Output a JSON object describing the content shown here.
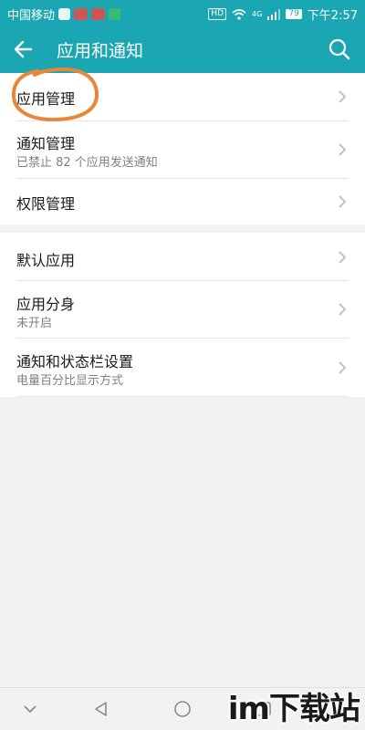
{
  "statusbar": {
    "carrier": "中国移动",
    "hd": "HD",
    "signal": "4G",
    "battery": "79",
    "time": "下午2:57",
    "app_icons": [
      "browser-icon",
      "news-icon",
      "video-icon",
      "play-icon"
    ]
  },
  "appbar": {
    "title": "应用和通知",
    "back_icon": "arrow-left-icon",
    "search_icon": "search-icon"
  },
  "group1": [
    {
      "label": "应用管理",
      "sub": ""
    },
    {
      "label": "通知管理",
      "sub": "已禁止 82 个应用发送通知"
    },
    {
      "label": "权限管理",
      "sub": ""
    }
  ],
  "group2": [
    {
      "label": "默认应用",
      "sub": ""
    },
    {
      "label": "应用分身",
      "sub": "未开启"
    },
    {
      "label": "通知和状态栏设置",
      "sub": "电量百分比显示方式"
    }
  ],
  "colors": {
    "accent": "#1ba6b3",
    "highlight": "#e8873a"
  },
  "watermark": "im下载站"
}
